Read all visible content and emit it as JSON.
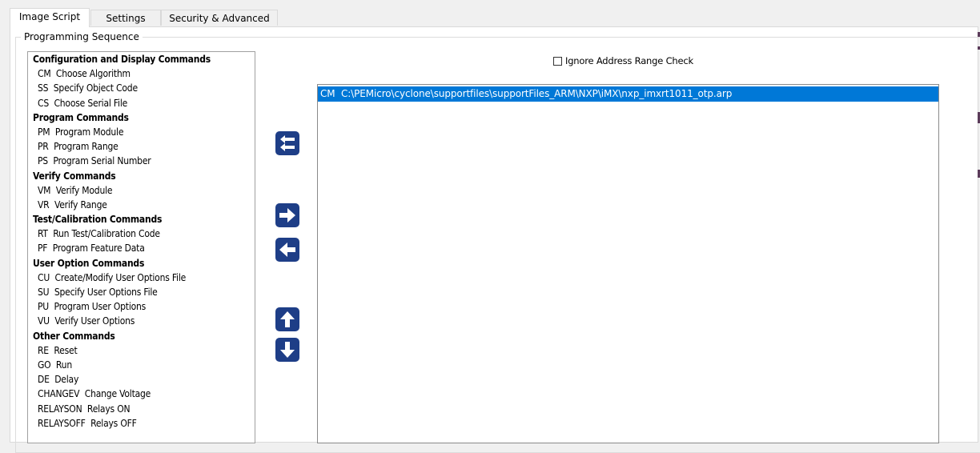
{
  "tabs": [
    {
      "label": "Image Script",
      "active": true
    },
    {
      "label": "Settings",
      "active": false
    },
    {
      "label": "Security & Advanced",
      "active": false
    }
  ],
  "group": {
    "legend": "Programming Sequence"
  },
  "commands": [
    {
      "text": "Configuration and Display Commands",
      "header": true
    },
    {
      "text": "CM  Choose Algorithm",
      "header": false
    },
    {
      "text": "SS  Specify Object Code",
      "header": false
    },
    {
      "text": "CS  Choose Serial File",
      "header": false
    },
    {
      "text": "Program Commands",
      "header": true
    },
    {
      "text": "PM  Program Module",
      "header": false
    },
    {
      "text": "PR  Program Range",
      "header": false
    },
    {
      "text": "PS  Program Serial Number",
      "header": false
    },
    {
      "text": "Verify Commands",
      "header": true
    },
    {
      "text": "VM  Verify Module",
      "header": false
    },
    {
      "text": "VR  Verify Range",
      "header": false
    },
    {
      "text": "Test/Calibration Commands",
      "header": true
    },
    {
      "text": "RT  Run Test/Calibration Code",
      "header": false
    },
    {
      "text": "PF  Program Feature Data",
      "header": false
    },
    {
      "text": "User Option Commands",
      "header": true
    },
    {
      "text": "CU  Create/Modify User Options File",
      "header": false
    },
    {
      "text": "SU  Specify User Options File",
      "header": false
    },
    {
      "text": "PU  Program User Options",
      "header": false
    },
    {
      "text": "VU  Verify User Options",
      "header": false
    },
    {
      "text": "Other Commands",
      "header": true
    },
    {
      "text": "RE  Reset",
      "header": false
    },
    {
      "text": "GO  Run",
      "header": false
    },
    {
      "text": "DE  Delay",
      "header": false
    },
    {
      "text": "CHANGEV  Change Voltage",
      "header": false
    },
    {
      "text": "RELAYSON  Relays ON",
      "header": false
    },
    {
      "text": "RELAYSOFF  Relays OFF",
      "header": false
    }
  ],
  "ignore_checkbox": {
    "label": "Ignore Address Range Check",
    "checked": false
  },
  "sequence": [
    {
      "text": "CM  C:\\PEMicro\\cyclone\\supportfiles\\supportFiles_ARM\\NXP\\iMX\\nxp_imxrt1011_otp.arp",
      "selected": true
    }
  ],
  "buttons": {
    "replace": "replace-icon",
    "add": "arrow-right-icon",
    "remove": "arrow-left-icon",
    "up": "arrow-up-icon",
    "down": "arrow-down-icon"
  },
  "colors": {
    "selection": "#0078d7",
    "button": "#1e3e87"
  }
}
